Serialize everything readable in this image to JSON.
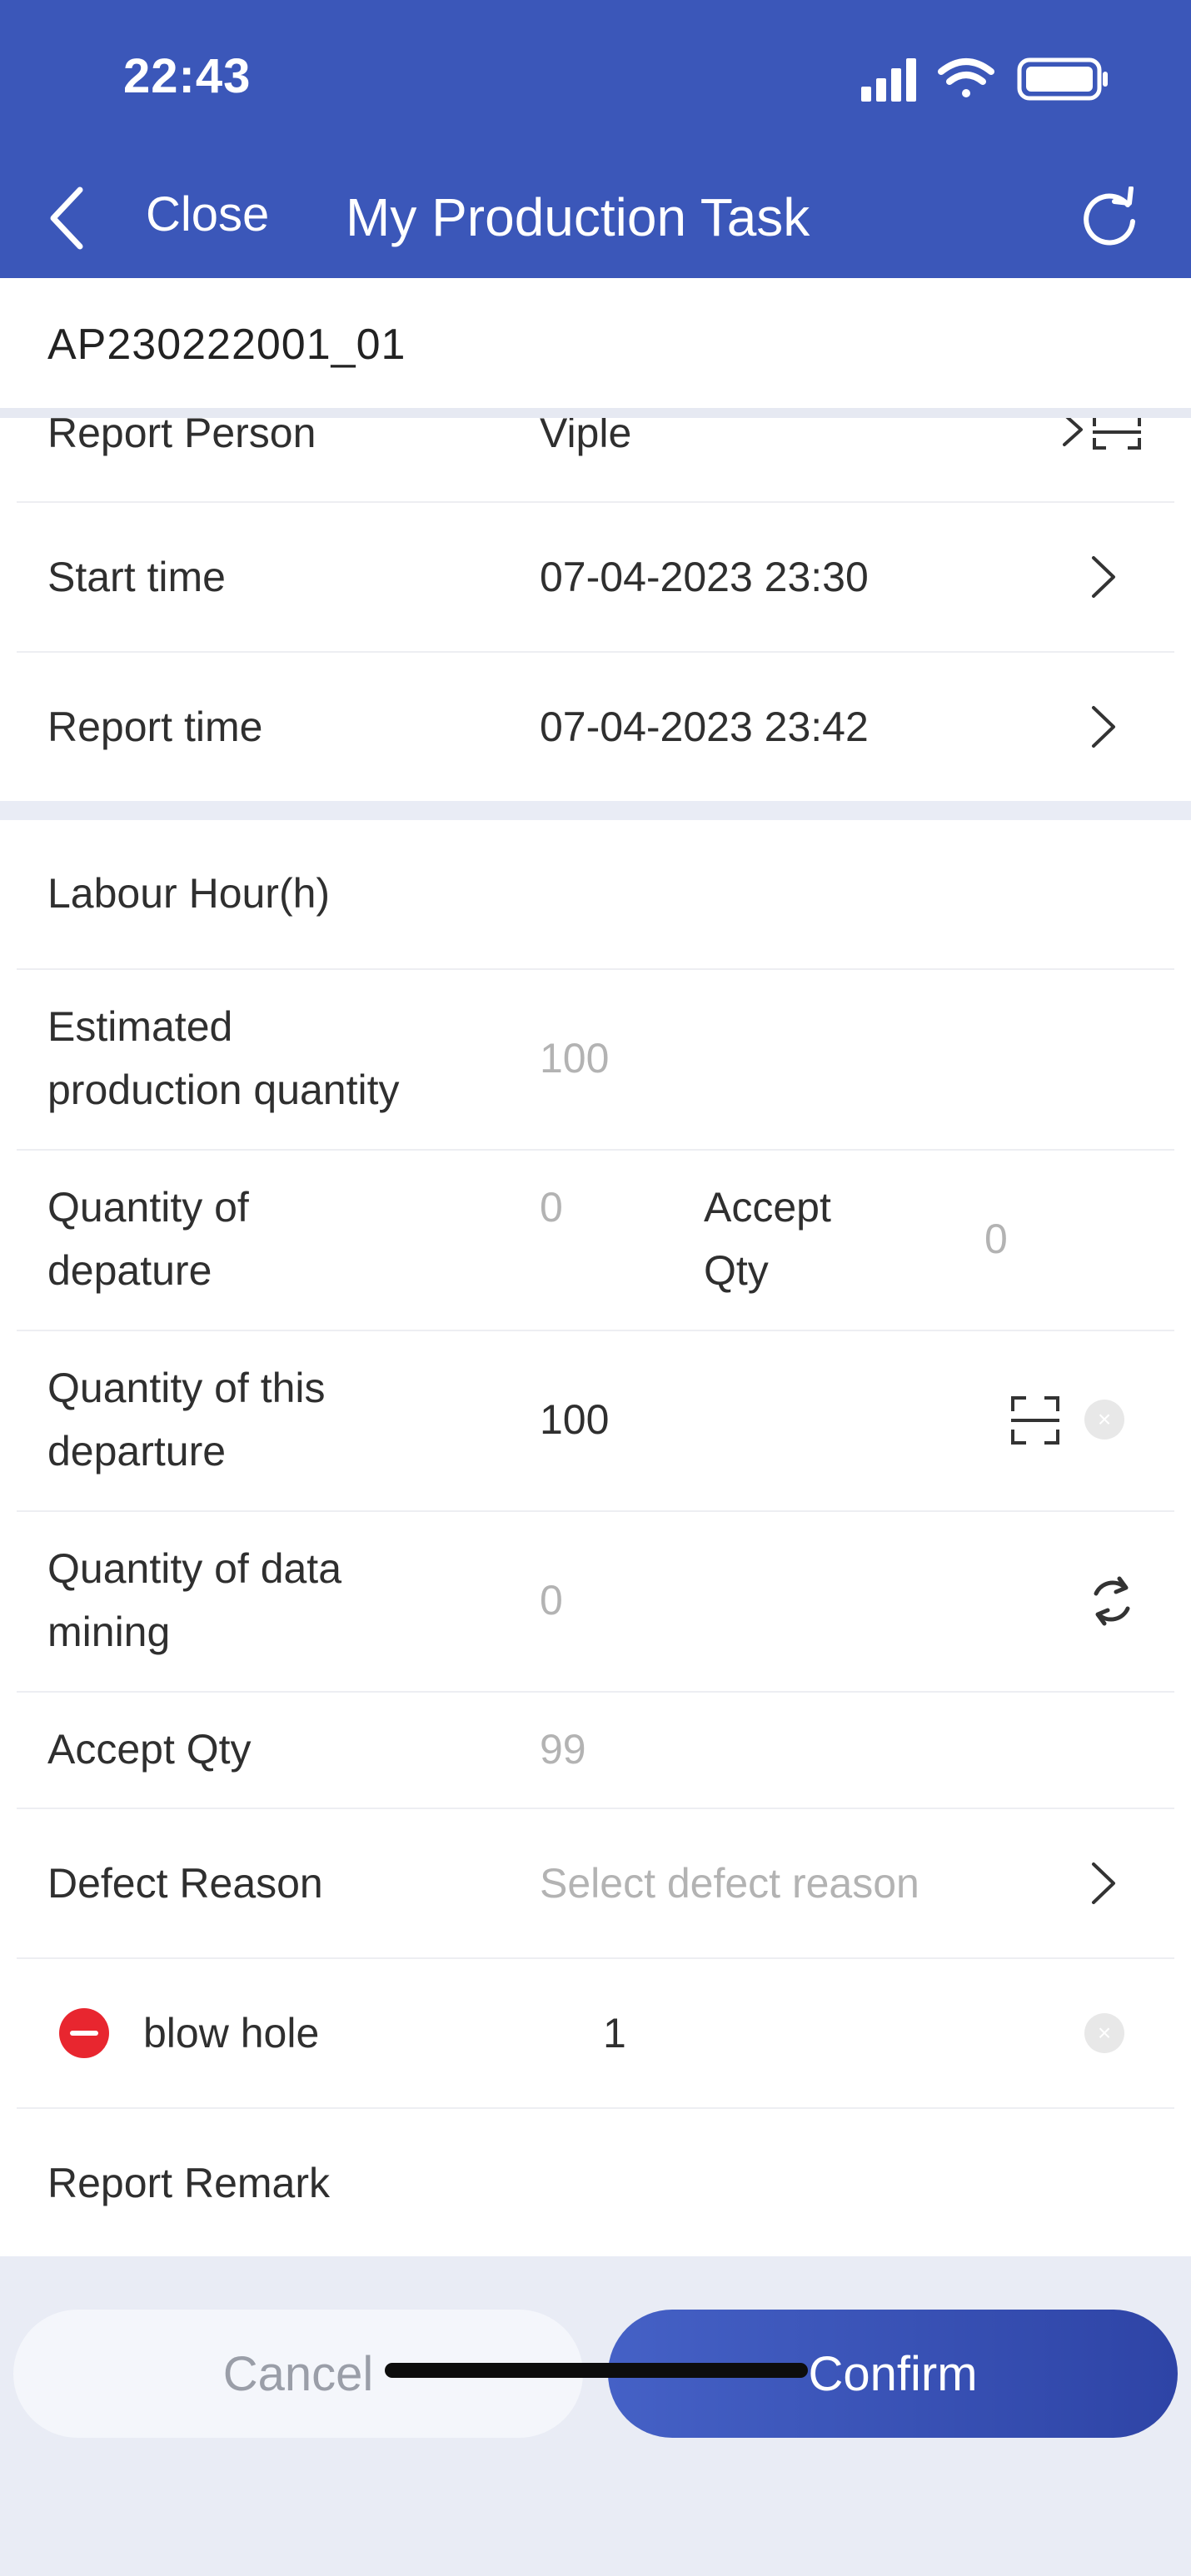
{
  "status_bar": {
    "time": "22:43"
  },
  "nav": {
    "back_icon": "chevron-left-icon",
    "close_label": "Close",
    "title": "My Production Task",
    "refresh_icon": "refresh-icon"
  },
  "task": {
    "code": "AP230222001_01"
  },
  "top_fields": {
    "report_person": {
      "label": "Report Person",
      "value": "Viple"
    },
    "start_time": {
      "label": "Start time",
      "value": "07-04-2023 23:30"
    },
    "report_time": {
      "label": "Report time",
      "value": "07-04-2023 23:42"
    }
  },
  "form": {
    "labour_hour": {
      "label": "Labour Hour(h)"
    },
    "estimated_qty": {
      "label_line1": "Estimated",
      "label_line2": "production quantity",
      "value": "100"
    },
    "departure_qty": {
      "label_line1": "Quantity of",
      "label_line2": "depature",
      "value": "0",
      "accept_label_line1": "Accept",
      "accept_label_line2": "Qty",
      "accept_value": "0"
    },
    "this_departure_qty": {
      "label_line1": "Quantity of this",
      "label_line2": "departure",
      "value": "100"
    },
    "data_mining_qty": {
      "label_line1": "Quantity of data",
      "label_line2": "mining",
      "value": "0"
    },
    "accept_qty": {
      "label": "Accept Qty",
      "value": "99"
    },
    "defect_reason": {
      "label": "Defect Reason",
      "placeholder": "Select defect reason"
    },
    "defects": [
      {
        "name": "blow hole",
        "qty": "1"
      }
    ],
    "report_remark": {
      "label": "Report Remark"
    }
  },
  "actions": {
    "cancel_label": "Cancel",
    "confirm_label": "Confirm"
  },
  "colors": {
    "brand": "#3b57b9",
    "danger": "#e8262f",
    "muted_text": "#b3b3b3"
  }
}
